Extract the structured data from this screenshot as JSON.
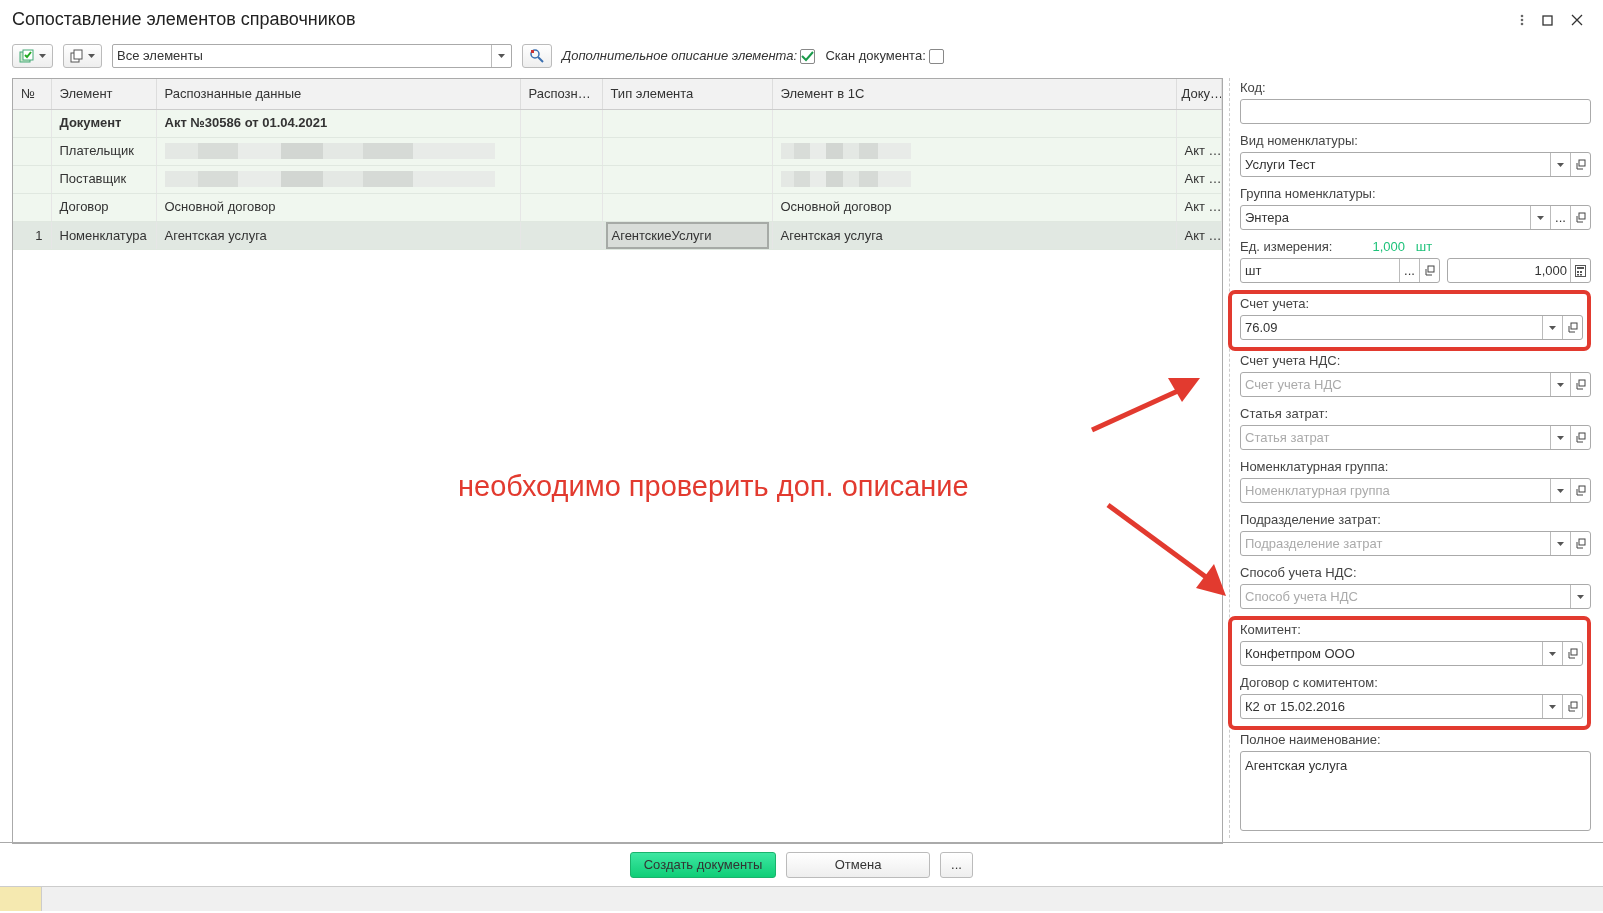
{
  "window": {
    "title": "Сопоставление элементов справочников"
  },
  "toolbar": {
    "filter": {
      "value": "Все элементы"
    },
    "extra_description": {
      "label": "Дополнительное описание элемента:",
      "checked": true
    },
    "scan": {
      "label": "Скан документа:",
      "checked": false
    }
  },
  "table": {
    "columns": [
      "№",
      "Элемент",
      "Распознанные данные",
      "Распозн…",
      "Тип элемента",
      "Элемент в 1С",
      "Доку…"
    ],
    "rows": [
      {
        "kind": "document",
        "selected": false,
        "cells": [
          "",
          "Документ",
          "Акт №30586 от 01.04.2021",
          "",
          "",
          "",
          ""
        ]
      },
      {
        "kind": "item",
        "selected": false,
        "cells": [
          "",
          "Плательщик",
          {
            "kind": "redacted"
          },
          "",
          "",
          {
            "kind": "redacted"
          },
          "Акт …"
        ]
      },
      {
        "kind": "item",
        "selected": false,
        "cells": [
          "",
          "Поставщик",
          {
            "kind": "redacted"
          },
          "",
          "",
          {
            "kind": "redacted"
          },
          "Акт …"
        ]
      },
      {
        "kind": "item",
        "selected": false,
        "cells": [
          "",
          "Договор",
          "Основной договор",
          "",
          "",
          "Основной договор",
          "Акт …"
        ]
      },
      {
        "kind": "item",
        "selected": true,
        "cells": [
          "1",
          "Номенклатура",
          "Агентская услуга",
          "",
          {
            "kind": "current",
            "text": "АгентскиеУслуги"
          },
          "Агентская услуга",
          "Акт …"
        ]
      }
    ]
  },
  "panel": {
    "sections": [
      {
        "highlighted": false,
        "fields": [
          {
            "kind": "text",
            "label": "Код:"
          },
          {
            "kind": "select",
            "label": "Вид номенклатуры:",
            "value": "Услуги Тест"
          },
          {
            "kind": "select_more",
            "label": "Группа номенклатуры:",
            "value": "Энтера",
            "more_label": "..."
          },
          {
            "kind": "unit",
            "label": "Ед. измерения:",
            "ratio": "1,000",
            "ratio_unit": "шт",
            "value": "шт",
            "more_label": "...",
            "quantity": "1,000"
          }
        ]
      },
      {
        "highlighted": true,
        "fields": [
          {
            "kind": "select",
            "label": "Счет учета:",
            "value": "76.09"
          }
        ]
      },
      {
        "highlighted": false,
        "fields": [
          {
            "kind": "select",
            "label": "Счет учета НДС:",
            "placeholder": "Счет учета НДС"
          },
          {
            "kind": "select",
            "label": "Статья затрат:",
            "placeholder": "Статья затрат"
          },
          {
            "kind": "select",
            "label": "Номенклатурная группа:",
            "placeholder": "Номенклатурная группа"
          },
          {
            "kind": "select",
            "label": "Подразделение затрат:",
            "placeholder": "Подразделение затрат"
          },
          {
            "kind": "dropdown",
            "label": "Способ учета НДС:",
            "placeholder": "Способ учета НДС"
          }
        ]
      },
      {
        "highlighted": true,
        "fields": [
          {
            "kind": "select",
            "label": "Комитент:",
            "value": "Конфетпром ООО"
          },
          {
            "kind": "select",
            "label": "Договор с комитентом:",
            "value": "К2 от 15.02.2016"
          }
        ]
      },
      {
        "highlighted": false,
        "fields": [
          {
            "kind": "textarea",
            "label": "Полное наименование:",
            "value": "Агентская услуга"
          }
        ]
      }
    ]
  },
  "annotation": {
    "text": "необходимо проверить доп. описание"
  },
  "footer": {
    "buttons": [
      {
        "label": "Создать документы",
        "kind": "primary"
      },
      {
        "label": "Отмена",
        "kind": "default"
      },
      {
        "label": "...",
        "kind": "more"
      }
    ]
  }
}
